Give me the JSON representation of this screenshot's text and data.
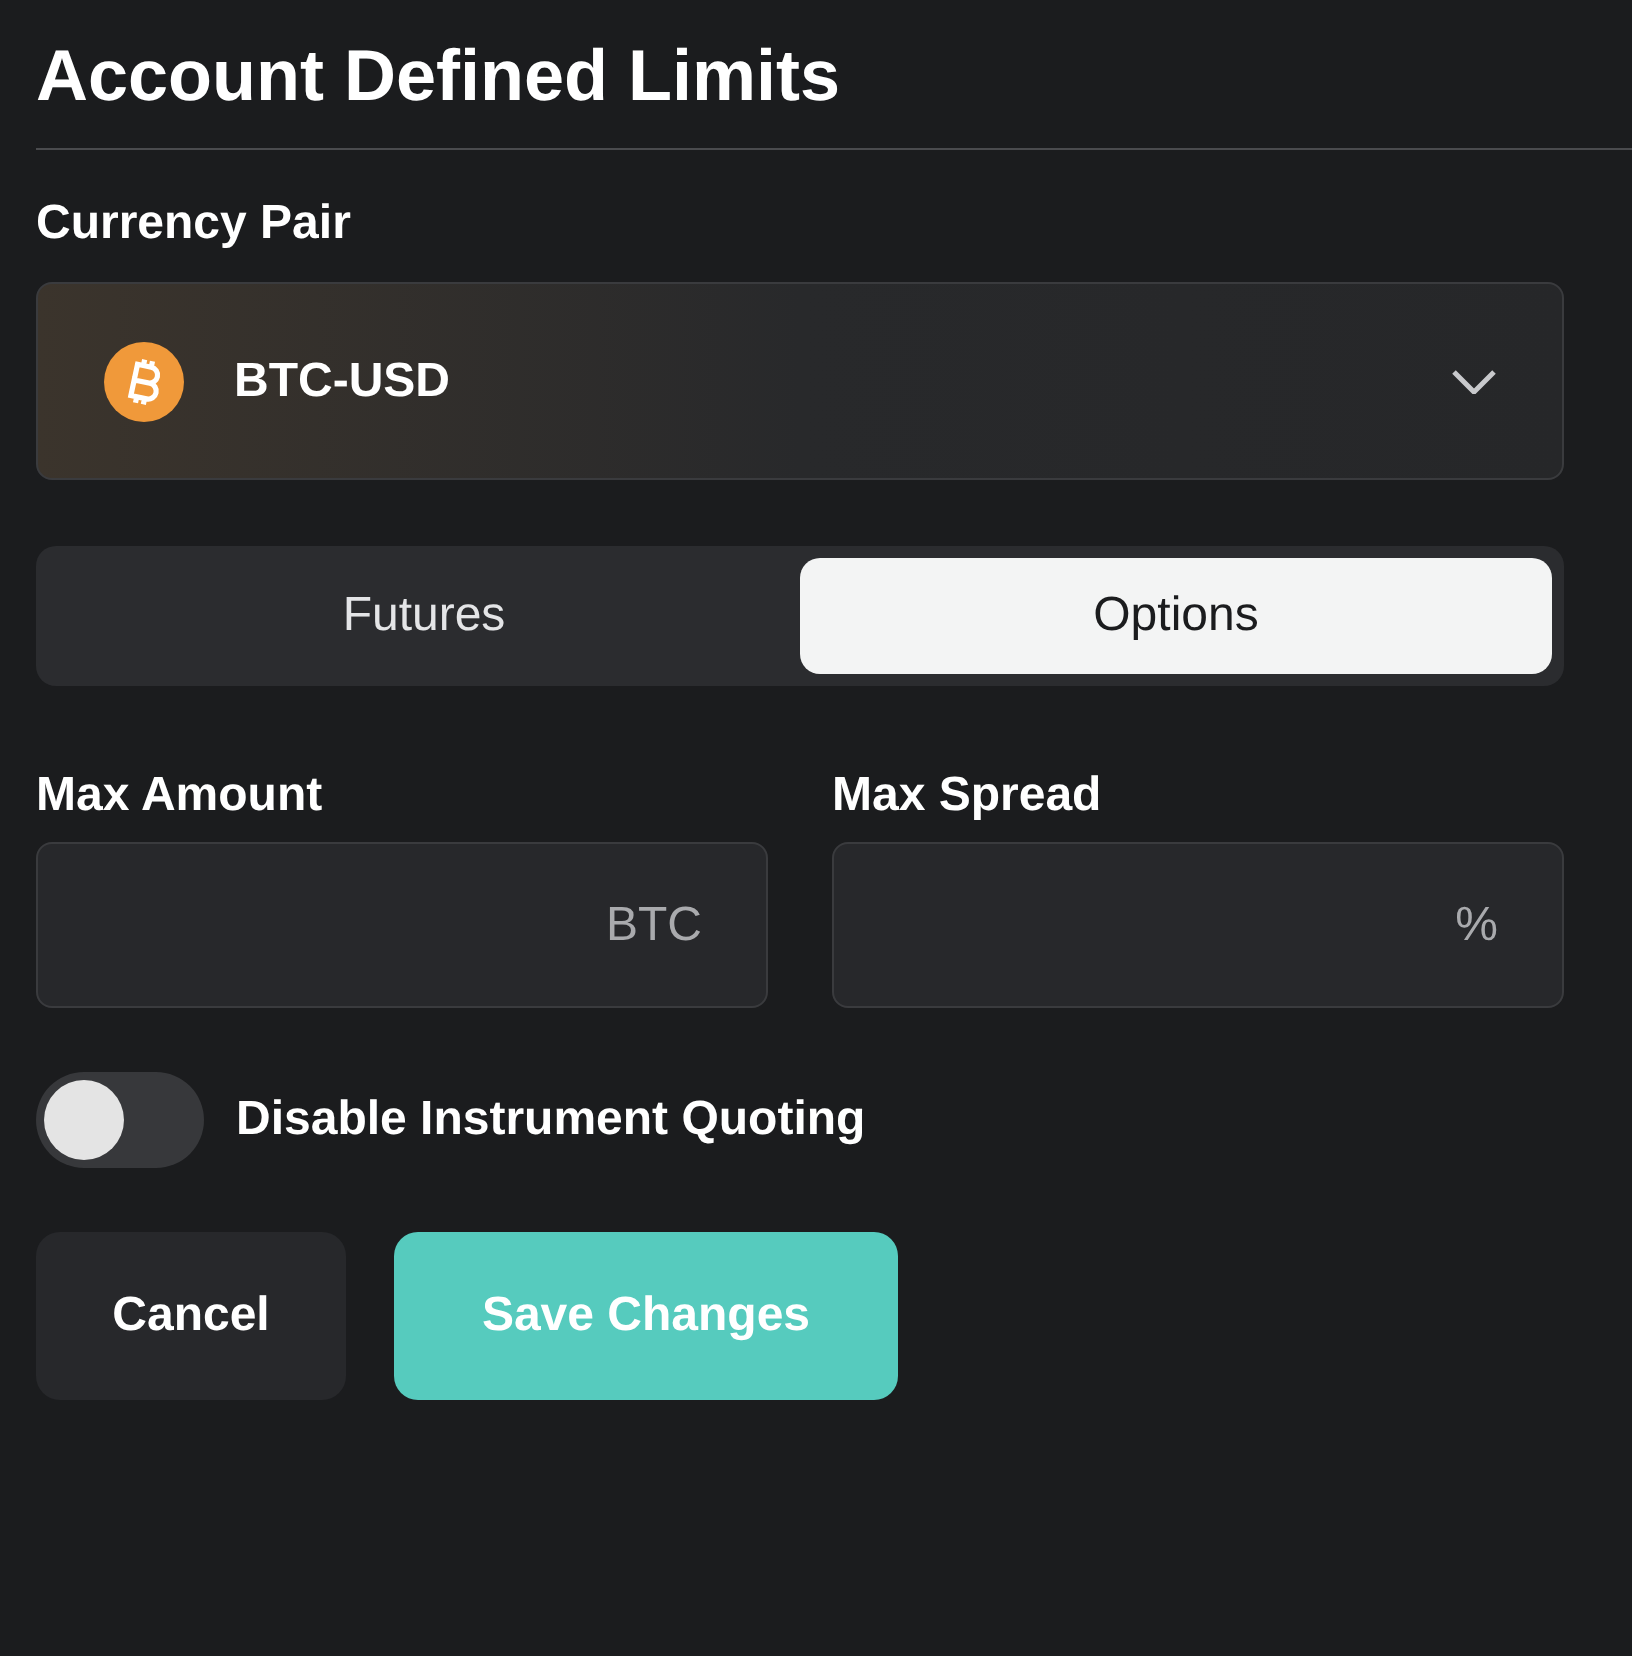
{
  "title": "Account Defined Limits",
  "currency_pair": {
    "label": "Currency Pair",
    "value": "BTC-USD"
  },
  "tabs": [
    {
      "label": "Futures",
      "selected": false
    },
    {
      "label": "Options",
      "selected": true
    }
  ],
  "fields": [
    {
      "label": "Max Amount",
      "unit": "BTC"
    },
    {
      "label": "Max Spread",
      "unit": "%"
    }
  ],
  "toggle": {
    "label": "Disable Instrument Quoting",
    "on": false
  },
  "buttons": [
    {
      "label": "Cancel",
      "kind": "secondary"
    },
    {
      "label": "Save Changes",
      "kind": "primary"
    }
  ]
}
